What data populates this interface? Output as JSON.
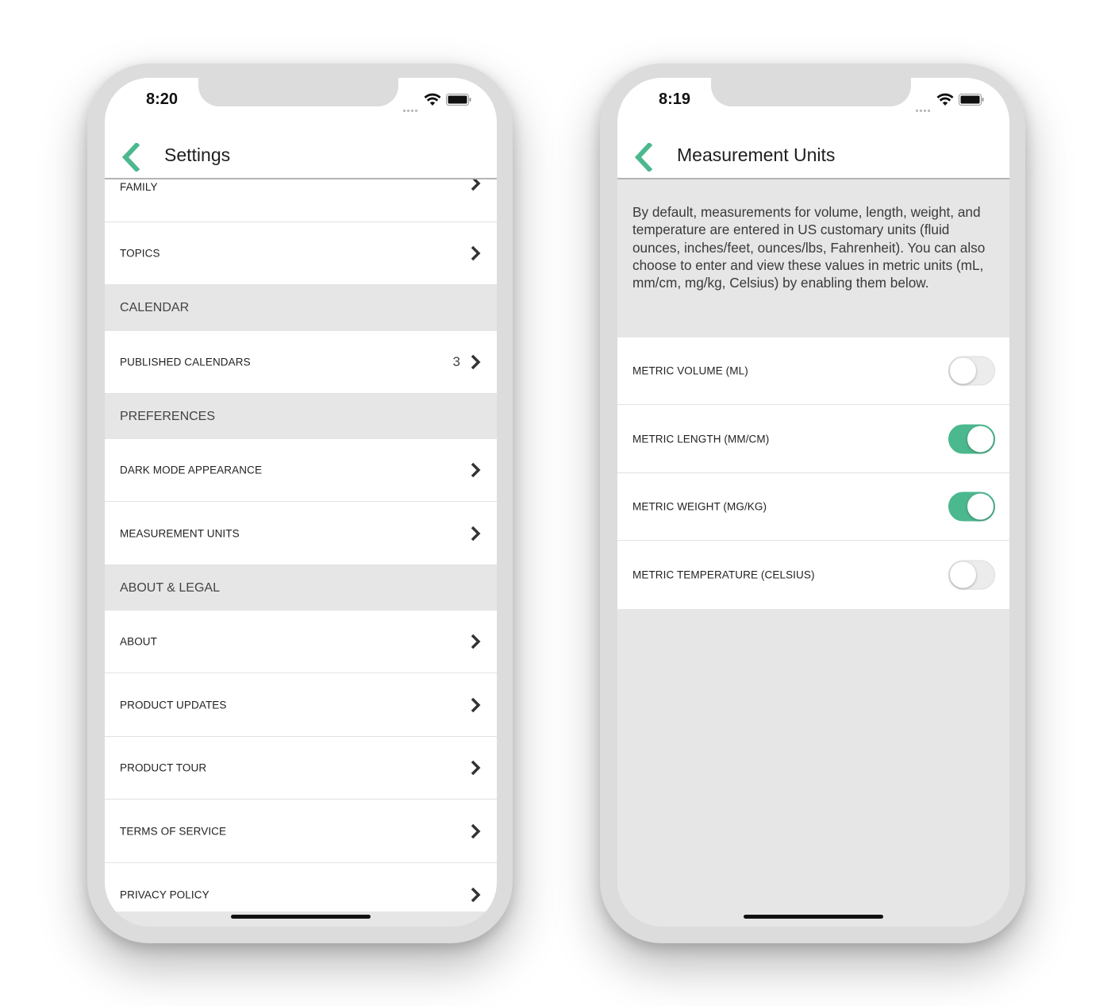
{
  "colors": {
    "accent": "#4cb88e",
    "section_bg": "#e6e6e6",
    "row_bg": "#ffffff"
  },
  "left": {
    "status": {
      "time": "8:20"
    },
    "nav": {
      "title": "Settings",
      "back_icon": "chevron-left-icon"
    },
    "partial_row": {
      "label": "FAMILY"
    },
    "rows": {
      "topics": {
        "label": "TOPICS"
      },
      "calendar_header": {
        "label": "CALENDAR"
      },
      "published_calendars": {
        "label": "PUBLISHED CALENDARS",
        "count": "3"
      },
      "preferences_header": {
        "label": "PREFERENCES"
      },
      "dark_mode": {
        "label": "DARK MODE APPEARANCE"
      },
      "measurement_units": {
        "label": "MEASUREMENT UNITS"
      },
      "about_header": {
        "label": "ABOUT & LEGAL"
      },
      "about": {
        "label": "ABOUT"
      },
      "product_updates": {
        "label": "PRODUCT UPDATES"
      },
      "product_tour": {
        "label": "PRODUCT TOUR"
      },
      "terms": {
        "label": "TERMS OF SERVICE"
      },
      "privacy": {
        "label": "PRIVACY POLICY"
      }
    }
  },
  "right": {
    "status": {
      "time": "8:19"
    },
    "nav": {
      "title": "Measurement Units",
      "back_icon": "chevron-left-icon"
    },
    "description": "By default, measurements for volume, length, weight, and temperature are entered in US customary units (fluid ounces, inches/feet, ounces/lbs, Fahrenheit). You can also choose to enter and view these values in metric units (mL, mm/cm, mg/kg, Celsius) by enabling them below.",
    "toggles": {
      "volume": {
        "label": "METRIC VOLUME (ML)",
        "on": false
      },
      "length": {
        "label": "METRIC LENGTH (MM/CM)",
        "on": true
      },
      "weight": {
        "label": "METRIC WEIGHT (MG/KG)",
        "on": true
      },
      "temperature": {
        "label": "METRIC TEMPERATURE (CELSIUS)",
        "on": false
      }
    }
  }
}
